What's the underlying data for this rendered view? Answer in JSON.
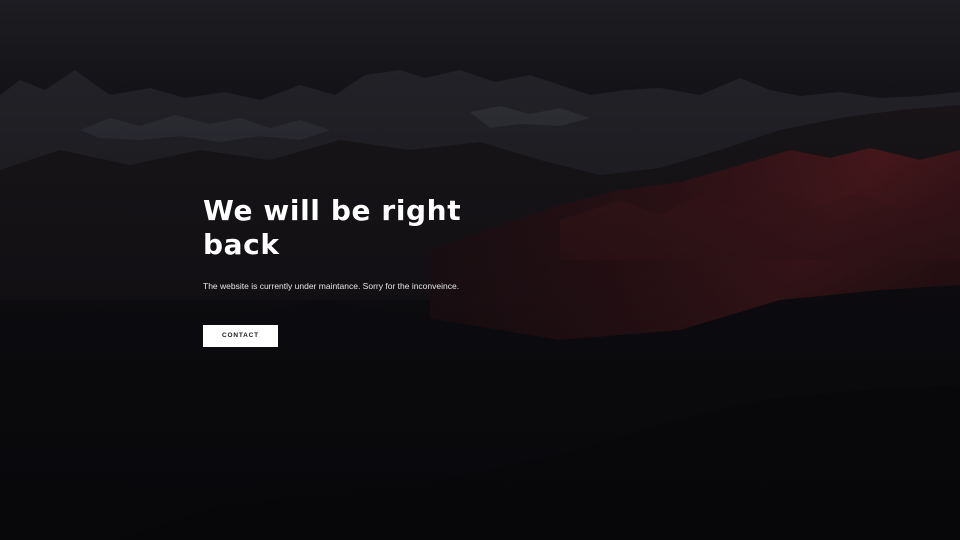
{
  "hero": {
    "headline": "We will be right back",
    "message": "The website is currently under maintance. Sorry for the inconveince.",
    "contact_label": "CONTACT"
  },
  "colors": {
    "background": "#0b0b0f",
    "text": "#ffffff",
    "button_background": "#ffffff",
    "button_text": "#1a1a1a",
    "mountain_accent": "#5a1a1e"
  }
}
